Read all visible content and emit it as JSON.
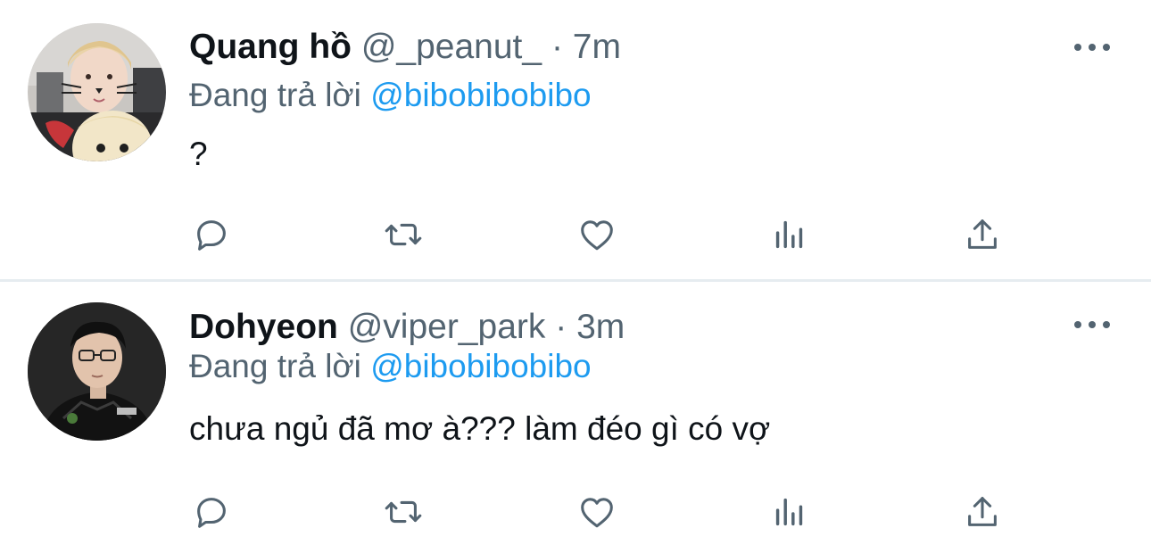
{
  "tweets": [
    {
      "display_name": "Quang hồ",
      "handle": "@_peanut_",
      "separator": "·",
      "time": "7m",
      "reply_prefix": "Đang trả lời",
      "reply_to": "@bibobibobibo",
      "text": "?"
    },
    {
      "display_name": "Dohyeon",
      "handle": "@viper_park",
      "separator": "·",
      "time": "3m",
      "reply_prefix": "Đang trả lời",
      "reply_to": "@bibobibobibo",
      "text": "chưa ngủ đã mơ à??? làm đéo gì có vợ"
    }
  ],
  "icons": {
    "reply": "reply-icon",
    "retweet": "retweet-icon",
    "like": "heart-icon",
    "views": "views-icon",
    "share": "share-icon",
    "more": "more-icon"
  },
  "colors": {
    "accent": "#1d9bf0",
    "secondary_text": "#536471",
    "primary_text": "#0f1419",
    "divider": "#e6ecf0"
  }
}
